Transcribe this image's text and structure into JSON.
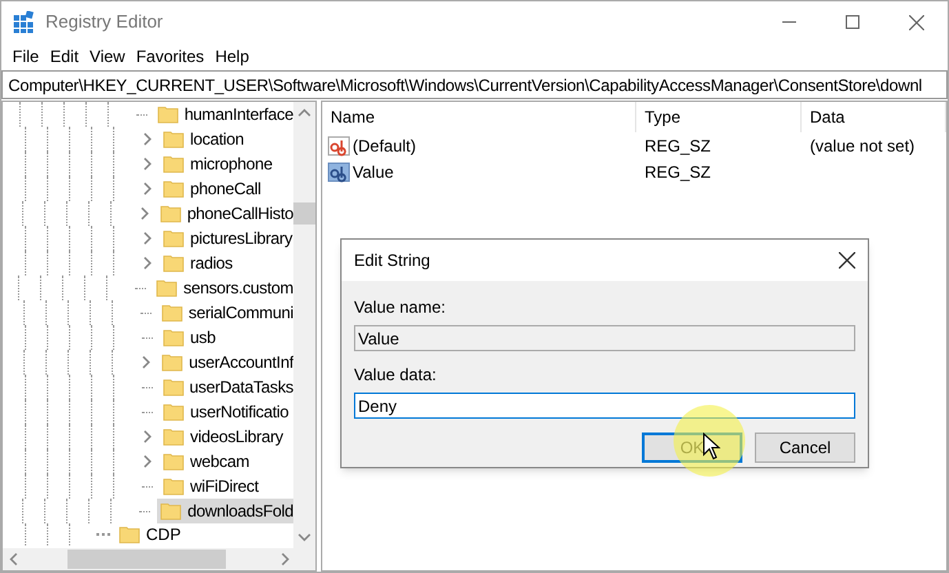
{
  "window": {
    "title": "Registry Editor"
  },
  "menu": [
    "File",
    "Edit",
    "View",
    "Favorites",
    "Help"
  ],
  "address": "Computer\\HKEY_CURRENT_USER\\Software\\Microsoft\\Windows\\CurrentVersion\\CapabilityAccessManager\\ConsentStore\\downl",
  "tree": {
    "items": [
      {
        "label": "humanInterface",
        "kind": "leaf",
        "selected": false
      },
      {
        "label": "location",
        "kind": "expandable",
        "selected": false
      },
      {
        "label": "microphone",
        "kind": "expandable",
        "selected": false
      },
      {
        "label": "phoneCall",
        "kind": "expandable",
        "selected": false
      },
      {
        "label": "phoneCallHisto",
        "kind": "expandable",
        "selected": false
      },
      {
        "label": "picturesLibrary",
        "kind": "expandable",
        "selected": false
      },
      {
        "label": "radios",
        "kind": "expandable",
        "selected": false
      },
      {
        "label": "sensors.custom",
        "kind": "leaf",
        "selected": false
      },
      {
        "label": "serialCommuni",
        "kind": "leaf",
        "selected": false
      },
      {
        "label": "usb",
        "kind": "leaf",
        "selected": false
      },
      {
        "label": "userAccountInf",
        "kind": "expandable",
        "selected": false
      },
      {
        "label": "userDataTasks",
        "kind": "leaf",
        "selected": false
      },
      {
        "label": "userNotificatio",
        "kind": "leaf",
        "selected": false
      },
      {
        "label": "videosLibrary",
        "kind": "expandable",
        "selected": false
      },
      {
        "label": "webcam",
        "kind": "expandable",
        "selected": false
      },
      {
        "label": "wiFiDirect",
        "kind": "leaf",
        "selected": false
      },
      {
        "label": "downloadsFold",
        "kind": "leaf",
        "selected": true
      }
    ],
    "outer_items": [
      {
        "label": "CDP",
        "kind": "leaf",
        "selected": false
      }
    ]
  },
  "values": {
    "columns": [
      "Name",
      "Type",
      "Data"
    ],
    "rows": [
      {
        "name": "(Default)",
        "type": "REG_SZ",
        "data": "(value not set)",
        "kind": "default"
      },
      {
        "name": "Value",
        "type": "REG_SZ",
        "data": "",
        "kind": "string"
      }
    ]
  },
  "dialog": {
    "title": "Edit String",
    "name_label": "Value name:",
    "name_value": "Value",
    "data_label": "Value data:",
    "data_value": "Deny",
    "buttons": [
      {
        "label": "OK",
        "focused": true
      },
      {
        "label": "Cancel",
        "focused": false
      }
    ]
  }
}
